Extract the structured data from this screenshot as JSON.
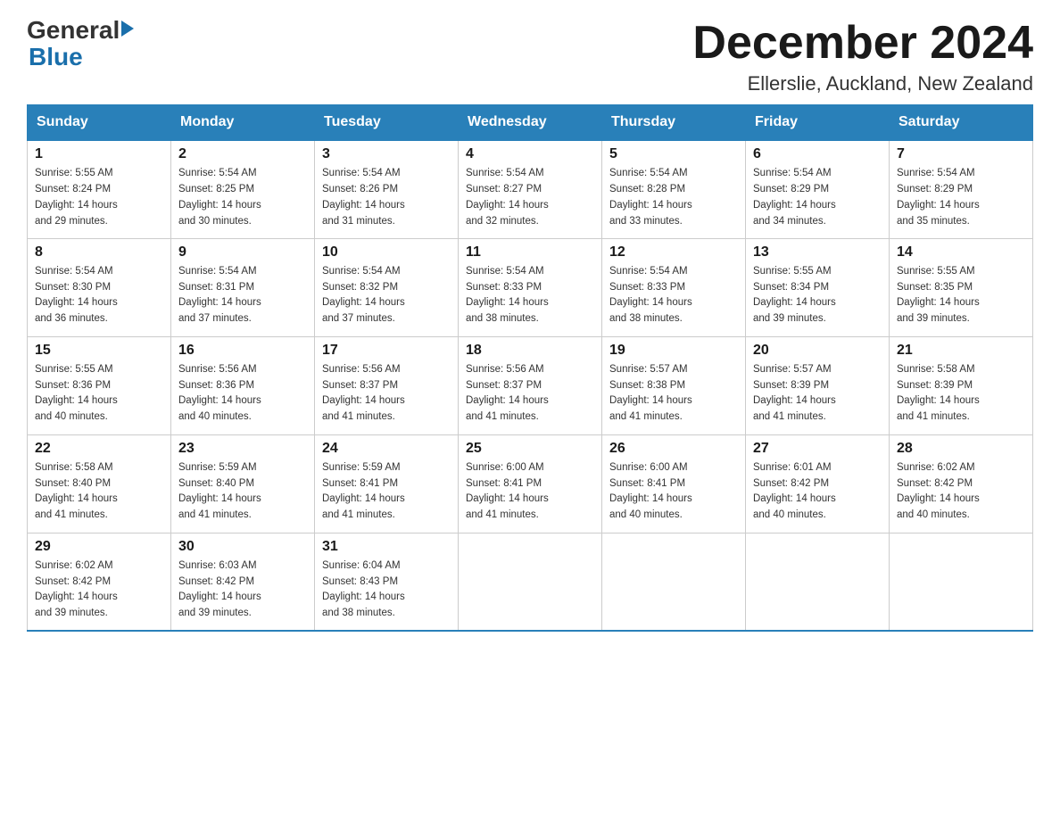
{
  "header": {
    "logo_general": "General",
    "logo_blue": "Blue",
    "month_title": "December 2024",
    "location": "Ellerslie, Auckland, New Zealand"
  },
  "days_of_week": [
    "Sunday",
    "Monday",
    "Tuesday",
    "Wednesday",
    "Thursday",
    "Friday",
    "Saturday"
  ],
  "weeks": [
    [
      {
        "day": "1",
        "sunrise": "5:55 AM",
        "sunset": "8:24 PM",
        "daylight": "14 hours and 29 minutes."
      },
      {
        "day": "2",
        "sunrise": "5:54 AM",
        "sunset": "8:25 PM",
        "daylight": "14 hours and 30 minutes."
      },
      {
        "day": "3",
        "sunrise": "5:54 AM",
        "sunset": "8:26 PM",
        "daylight": "14 hours and 31 minutes."
      },
      {
        "day": "4",
        "sunrise": "5:54 AM",
        "sunset": "8:27 PM",
        "daylight": "14 hours and 32 minutes."
      },
      {
        "day": "5",
        "sunrise": "5:54 AM",
        "sunset": "8:28 PM",
        "daylight": "14 hours and 33 minutes."
      },
      {
        "day": "6",
        "sunrise": "5:54 AM",
        "sunset": "8:29 PM",
        "daylight": "14 hours and 34 minutes."
      },
      {
        "day": "7",
        "sunrise": "5:54 AM",
        "sunset": "8:29 PM",
        "daylight": "14 hours and 35 minutes."
      }
    ],
    [
      {
        "day": "8",
        "sunrise": "5:54 AM",
        "sunset": "8:30 PM",
        "daylight": "14 hours and 36 minutes."
      },
      {
        "day": "9",
        "sunrise": "5:54 AM",
        "sunset": "8:31 PM",
        "daylight": "14 hours and 37 minutes."
      },
      {
        "day": "10",
        "sunrise": "5:54 AM",
        "sunset": "8:32 PM",
        "daylight": "14 hours and 37 minutes."
      },
      {
        "day": "11",
        "sunrise": "5:54 AM",
        "sunset": "8:33 PM",
        "daylight": "14 hours and 38 minutes."
      },
      {
        "day": "12",
        "sunrise": "5:54 AM",
        "sunset": "8:33 PM",
        "daylight": "14 hours and 38 minutes."
      },
      {
        "day": "13",
        "sunrise": "5:55 AM",
        "sunset": "8:34 PM",
        "daylight": "14 hours and 39 minutes."
      },
      {
        "day": "14",
        "sunrise": "5:55 AM",
        "sunset": "8:35 PM",
        "daylight": "14 hours and 39 minutes."
      }
    ],
    [
      {
        "day": "15",
        "sunrise": "5:55 AM",
        "sunset": "8:36 PM",
        "daylight": "14 hours and 40 minutes."
      },
      {
        "day": "16",
        "sunrise": "5:56 AM",
        "sunset": "8:36 PM",
        "daylight": "14 hours and 40 minutes."
      },
      {
        "day": "17",
        "sunrise": "5:56 AM",
        "sunset": "8:37 PM",
        "daylight": "14 hours and 41 minutes."
      },
      {
        "day": "18",
        "sunrise": "5:56 AM",
        "sunset": "8:37 PM",
        "daylight": "14 hours and 41 minutes."
      },
      {
        "day": "19",
        "sunrise": "5:57 AM",
        "sunset": "8:38 PM",
        "daylight": "14 hours and 41 minutes."
      },
      {
        "day": "20",
        "sunrise": "5:57 AM",
        "sunset": "8:39 PM",
        "daylight": "14 hours and 41 minutes."
      },
      {
        "day": "21",
        "sunrise": "5:58 AM",
        "sunset": "8:39 PM",
        "daylight": "14 hours and 41 minutes."
      }
    ],
    [
      {
        "day": "22",
        "sunrise": "5:58 AM",
        "sunset": "8:40 PM",
        "daylight": "14 hours and 41 minutes."
      },
      {
        "day": "23",
        "sunrise": "5:59 AM",
        "sunset": "8:40 PM",
        "daylight": "14 hours and 41 minutes."
      },
      {
        "day": "24",
        "sunrise": "5:59 AM",
        "sunset": "8:41 PM",
        "daylight": "14 hours and 41 minutes."
      },
      {
        "day": "25",
        "sunrise": "6:00 AM",
        "sunset": "8:41 PM",
        "daylight": "14 hours and 41 minutes."
      },
      {
        "day": "26",
        "sunrise": "6:00 AM",
        "sunset": "8:41 PM",
        "daylight": "14 hours and 40 minutes."
      },
      {
        "day": "27",
        "sunrise": "6:01 AM",
        "sunset": "8:42 PM",
        "daylight": "14 hours and 40 minutes."
      },
      {
        "day": "28",
        "sunrise": "6:02 AM",
        "sunset": "8:42 PM",
        "daylight": "14 hours and 40 minutes."
      }
    ],
    [
      {
        "day": "29",
        "sunrise": "6:02 AM",
        "sunset": "8:42 PM",
        "daylight": "14 hours and 39 minutes."
      },
      {
        "day": "30",
        "sunrise": "6:03 AM",
        "sunset": "8:42 PM",
        "daylight": "14 hours and 39 minutes."
      },
      {
        "day": "31",
        "sunrise": "6:04 AM",
        "sunset": "8:43 PM",
        "daylight": "14 hours and 38 minutes."
      },
      null,
      null,
      null,
      null
    ]
  ]
}
